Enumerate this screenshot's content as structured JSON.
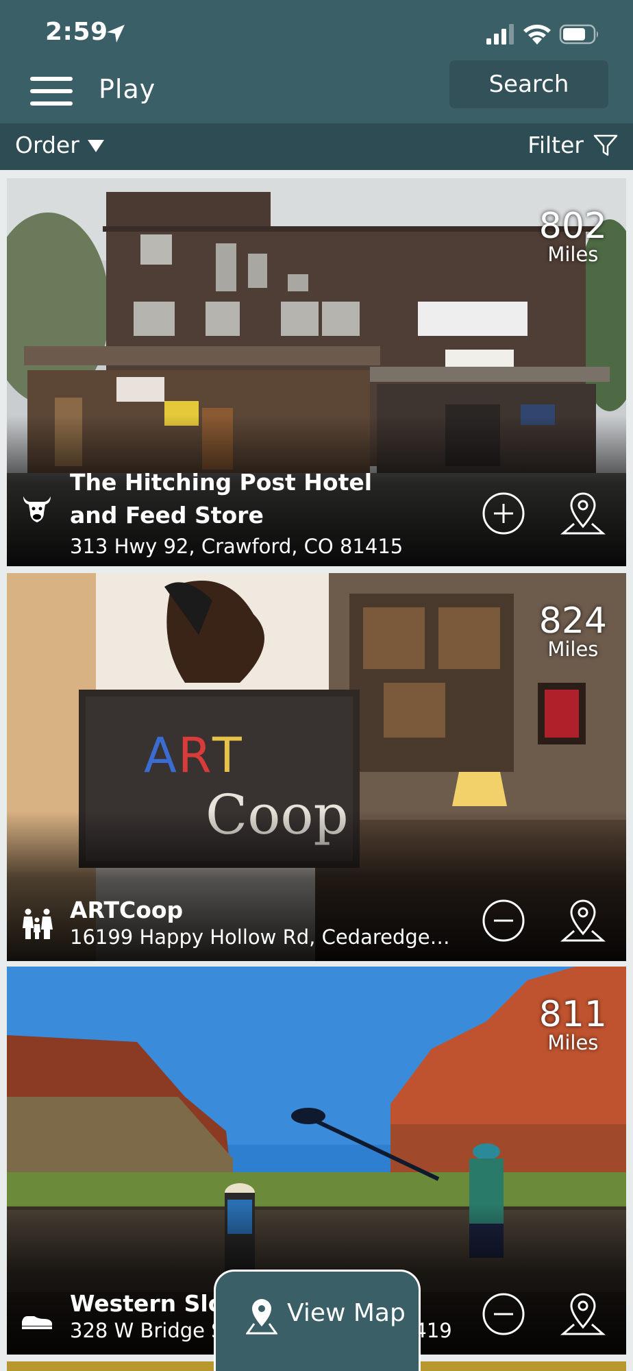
{
  "status_bar": {
    "time": "2:59"
  },
  "header": {
    "title": "Play",
    "search_label": "Search"
  },
  "toolbar": {
    "order_label": "Order",
    "filter_label": "Filter"
  },
  "listings": [
    {
      "name": "The Hitching Post Hotel and Feed Store",
      "address": "313 Hwy 92, Crawford, CO 81415",
      "distance": "802",
      "unit": "Miles",
      "category_icon": "cow-icon",
      "action": "add"
    },
    {
      "name": "ARTCoop",
      "address": "16199 Happy Hollow Rd, Cedaredge,...",
      "distance": "824",
      "unit": "Miles",
      "category_icon": "family-icon",
      "action": "remove"
    },
    {
      "name": "Western Slope",
      "address": "328 W Bridge St, Hotchkiss, CO 81419",
      "distance": "811",
      "unit": "Miles",
      "category_icon": "shoe-icon",
      "action": "remove"
    }
  ],
  "view_map": {
    "label": "View Map"
  },
  "colors": {
    "header_bg": "#3b5f67",
    "toolbar_bg": "#2d4c53",
    "search_bg": "#335158"
  }
}
